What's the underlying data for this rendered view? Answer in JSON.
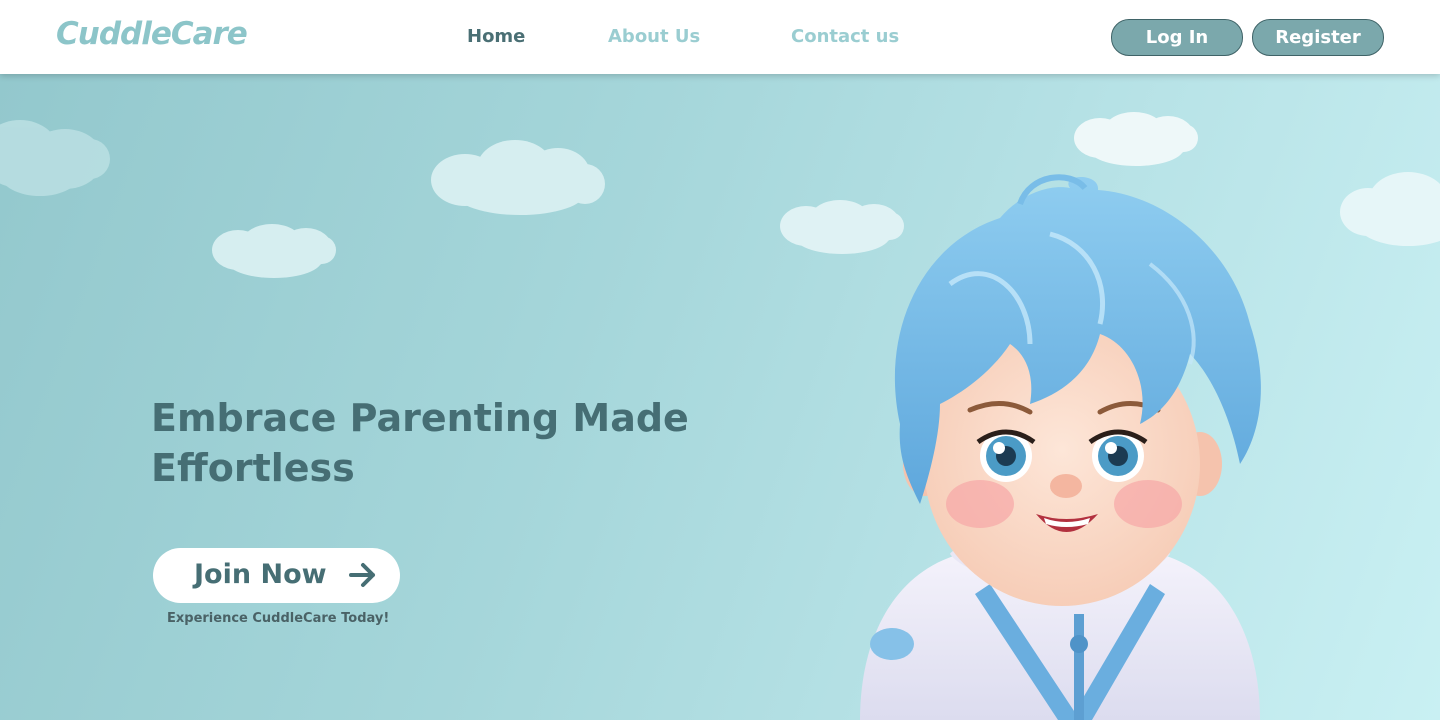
{
  "nav": {
    "logo": "CuddleCare",
    "links": [
      {
        "label": "Home",
        "active": true
      },
      {
        "label": "About Us",
        "active": false
      },
      {
        "label": "Contact us",
        "active": false
      }
    ],
    "login_label": "Log In",
    "register_label": "Register"
  },
  "hero": {
    "headline_line1": "Embrace Parenting Made",
    "headline_line2": "Effortless",
    "cta_label": "Join Now",
    "cta_icon": "arrow-right-icon",
    "tagline": "Experience CuddleCare Today!"
  },
  "colors": {
    "logo": "#8cc5c9",
    "nav_active": "#4a6f74",
    "nav_inactive": "#9acdd1",
    "button_fill": "#7ba8ac",
    "button_border": "#3f6367",
    "headline": "#466e74",
    "hero_bg_start": "#93c8cd",
    "hero_bg_end": "#c9f0f3"
  }
}
